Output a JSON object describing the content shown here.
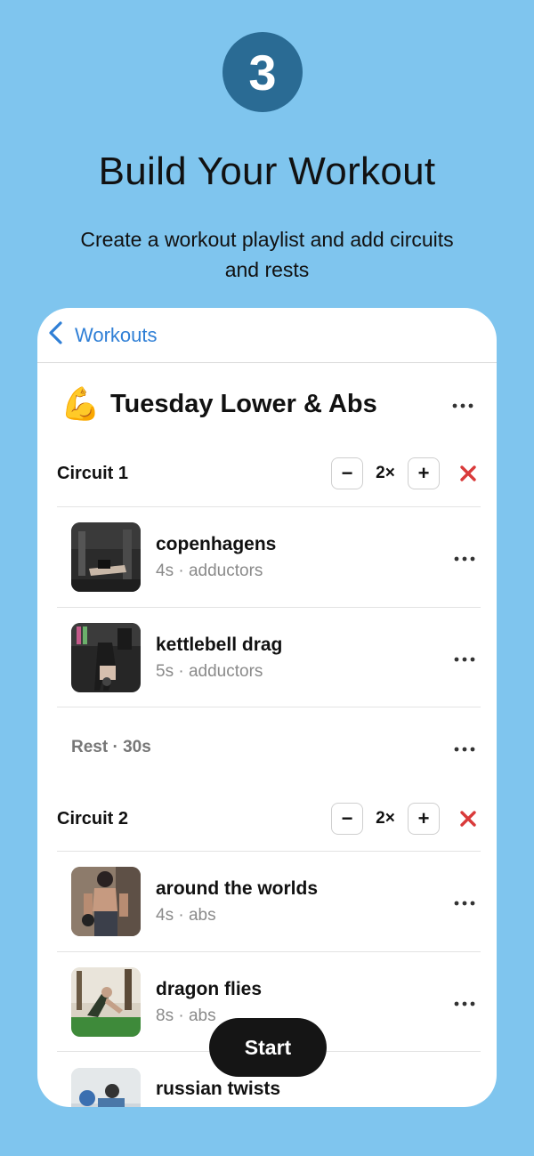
{
  "promo": {
    "step_number": "3",
    "title": "Build Your Workout",
    "subtitle": "Create a workout playlist and add circuits and rests"
  },
  "nav": {
    "back_label": "Workouts"
  },
  "workout": {
    "emoji": "💪",
    "title": "Tuesday Lower & Abs"
  },
  "circuits": [
    {
      "label": "Circuit 1",
      "count": "2×",
      "exercises": [
        {
          "name": "copenhagens",
          "meta": "4s · adductors"
        },
        {
          "name": "kettlebell drag",
          "meta": "5s · adductors"
        }
      ]
    },
    {
      "label": "Circuit 2",
      "count": "2×",
      "exercises": [
        {
          "name": "around the worlds",
          "meta": "4s · abs"
        },
        {
          "name": "dragon flies",
          "meta": "8s · abs"
        },
        {
          "name": "russian twists",
          "meta": ""
        }
      ]
    }
  ],
  "rest": {
    "label": "Rest · 30s"
  },
  "start_button": {
    "label": "Start"
  },
  "colors": {
    "background": "#7fc5ee",
    "badge": "#2a6b94",
    "accent": "#2f7fd6",
    "remove": "#d93a3a"
  }
}
